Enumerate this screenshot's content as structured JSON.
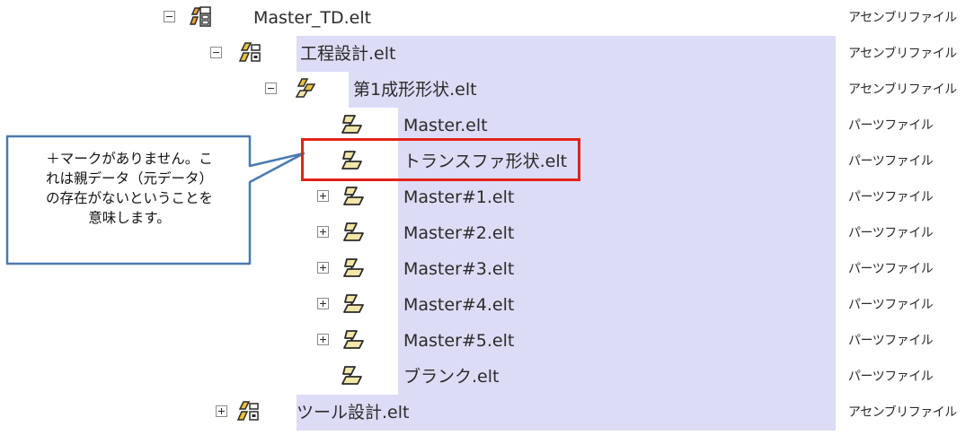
{
  "tree": [
    {
      "label": "Master_TD.elt",
      "type": "アセンブリファイル",
      "toggle": "minus",
      "icon": "assembly-root-icon"
    },
    {
      "label": "工程設計.elt",
      "type": "アセンブリファイル",
      "toggle": "minus",
      "icon": "assembly-icon"
    },
    {
      "label": "第1成形形状.elt",
      "type": "アセンブリファイル",
      "toggle": "minus",
      "icon": "assembly-icon"
    },
    {
      "label": "Master.elt",
      "type": "パーツファイル",
      "toggle": "none",
      "icon": "part-icon"
    },
    {
      "label": "トランスファ形状.elt",
      "type": "パーツファイル",
      "toggle": "none",
      "icon": "part-icon"
    },
    {
      "label": "Master#1.elt",
      "type": "パーツファイル",
      "toggle": "plus",
      "icon": "part-icon"
    },
    {
      "label": "Master#2.elt",
      "type": "パーツファイル",
      "toggle": "plus",
      "icon": "part-icon"
    },
    {
      "label": "Master#3.elt",
      "type": "パーツファイル",
      "toggle": "plus",
      "icon": "part-icon"
    },
    {
      "label": "Master#4.elt",
      "type": "パーツファイル",
      "toggle": "plus",
      "icon": "part-icon"
    },
    {
      "label": "Master#5.elt",
      "type": "パーツファイル",
      "toggle": "plus",
      "icon": "part-icon"
    },
    {
      "label": "ブランク.elt",
      "type": "パーツファイル",
      "toggle": "none",
      "icon": "part-icon"
    },
    {
      "label": "ツール設計.elt",
      "type": "アセンブリファイル",
      "toggle": "plus",
      "icon": "assembly-icon"
    }
  ],
  "callout": {
    "lines": [
      "＋マークがありません。こ",
      "れは親データ（元データ）",
      "の存在がないということを",
      "意味します。"
    ]
  },
  "colors": {
    "selection": "#dcdcf6",
    "highlight_border": "#e2231a",
    "callout_border": "#4a7ab0"
  }
}
